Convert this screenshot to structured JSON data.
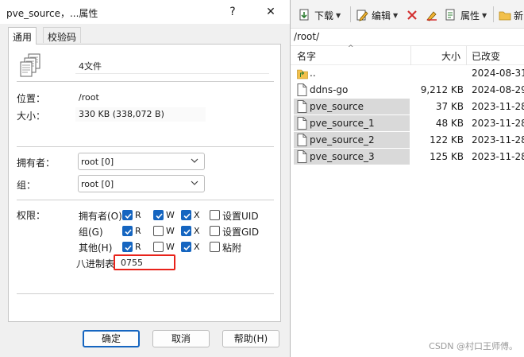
{
  "file_manager": {
    "toolbar": {
      "download": "下载",
      "edit": "编辑",
      "properties": "属性",
      "new_partial": "新"
    },
    "path": "/root/",
    "columns": {
      "name": "名字",
      "size": "大小",
      "modified": "已改变"
    },
    "files": [
      {
        "name": "..",
        "size": "",
        "date": "2024-08-31",
        "kind": "up",
        "selected": false
      },
      {
        "name": "ddns-go",
        "size": "9,212 KB",
        "date": "2024-08-29",
        "kind": "file",
        "selected": false
      },
      {
        "name": "pve_source",
        "size": "37 KB",
        "date": "2023-11-28",
        "kind": "file",
        "selected": true
      },
      {
        "name": "pve_source_1",
        "size": "48 KB",
        "date": "2023-11-28",
        "kind": "file",
        "selected": true
      },
      {
        "name": "pve_source_2",
        "size": "122 KB",
        "date": "2023-11-28",
        "kind": "file",
        "selected": true
      },
      {
        "name": "pve_source_3",
        "size": "125 KB",
        "date": "2023-11-28",
        "kind": "file",
        "selected": true
      }
    ],
    "watermark": "CSDN @村口王师傅。"
  },
  "dialog": {
    "title": "pve_source，...属性",
    "help_glyph": "?",
    "close_glyph": "✕",
    "tabs": {
      "general": "通用",
      "checksum": "校验码"
    },
    "file_count": "4文件",
    "location_label": "位置：",
    "location_value": "/root",
    "size_label": "大小：",
    "size_value": "330 KB (338,072 B)",
    "owner_label": "拥有者：",
    "owner_value": "root [0]",
    "group_label": "组：",
    "group_value": "root [0]",
    "permissions_label": "权限：",
    "perm_rows": {
      "owner": "拥有者(O)",
      "group": "组(G)",
      "other": "其他(H)"
    },
    "perm_letters": {
      "r": "R",
      "w": "W",
      "x": "X"
    },
    "special": {
      "setuid": "设置UID",
      "setgid": "设置GID",
      "sticky": "粘附"
    },
    "perm_state": {
      "owner": {
        "r": true,
        "w": true,
        "x": true,
        "special": false
      },
      "group": {
        "r": true,
        "w": false,
        "x": true,
        "special": false
      },
      "other": {
        "r": true,
        "w": false,
        "x": true,
        "special": false
      }
    },
    "octal_label": "八进制表",
    "octal_value": "0755",
    "buttons": {
      "ok": "确定",
      "cancel": "取消",
      "help": "帮助(H)"
    }
  },
  "colors": {
    "checkbox_on": "#1565c0",
    "highlight_box": "#e8221a",
    "selection": "#d9d9d9",
    "folder": "#f2c04b"
  }
}
